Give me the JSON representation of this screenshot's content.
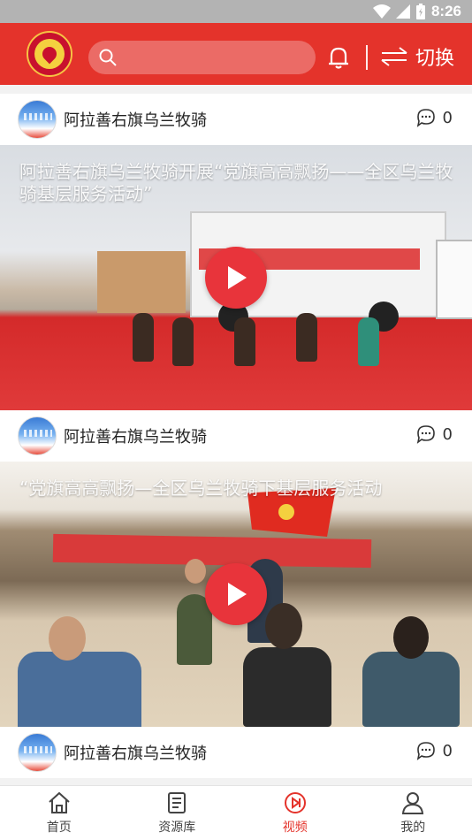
{
  "status_bar": {
    "time": "8:26"
  },
  "header": {
    "search_placeholder": "",
    "switch_label": "切换"
  },
  "feed": [
    {
      "author": "阿拉善右旗乌兰牧骑",
      "comments": "0",
      "video_title": "阿拉善右旗乌兰牧骑开展“党旗高高飘扬——全区乌兰牧骑基层服务活动”"
    },
    {
      "author": "阿拉善右旗乌兰牧骑",
      "comments": "0",
      "video_title": "“党旗高高飘扬—全区乌兰牧骑下基层服务活动"
    },
    {
      "author": "阿拉善右旗乌兰牧骑",
      "comments": "0"
    }
  ],
  "bottom_nav": [
    {
      "label": "首页",
      "icon": "home-icon",
      "active": false
    },
    {
      "label": "资源库",
      "icon": "document-icon",
      "active": false
    },
    {
      "label": "视频",
      "icon": "video-play-icon",
      "active": true
    },
    {
      "label": "我的",
      "icon": "user-icon",
      "active": false
    }
  ],
  "colors": {
    "brand_red": "#e4332b",
    "play_red": "#e8343b"
  }
}
